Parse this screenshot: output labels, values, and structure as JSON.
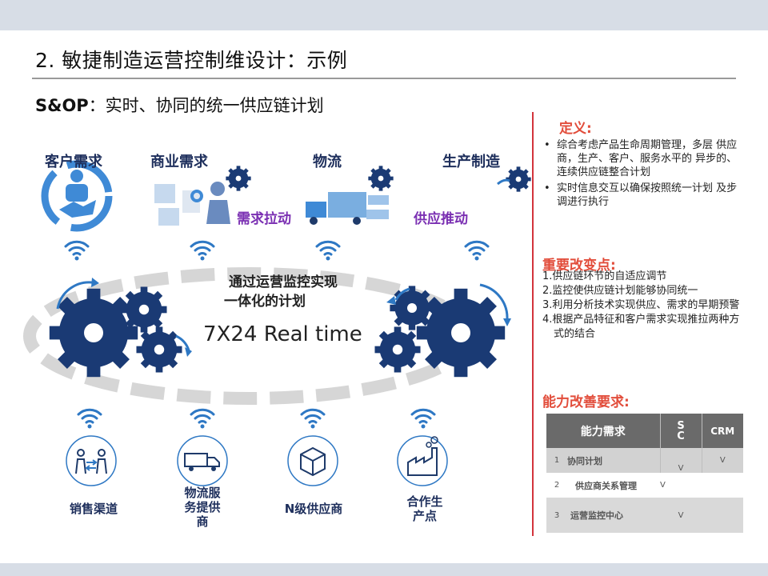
{
  "slide": {
    "title": "2. 敏捷制造运营控制维设计：示例",
    "subtitle_prefix": "S&OP",
    "subtitle_rest": "：实时、协同的统一供应链计划"
  },
  "top_nodes": [
    {
      "label": "客户需求",
      "icon": "customer-handshake-icon"
    },
    {
      "label": "商业需求",
      "icon": "business-people-icon"
    },
    {
      "label": "物流",
      "icon": "truck-icon"
    },
    {
      "label": "生产制造",
      "icon": "gear-icon"
    }
  ],
  "flows": {
    "pull": "需求拉动",
    "push": "供应推动"
  },
  "center": {
    "line1": "通过运营监控实现",
    "line2": "一体化的计划",
    "realtime": "7X24 Real time"
  },
  "bottom_nodes": [
    {
      "label": "销售渠道",
      "icon": "people-exchange-icon"
    },
    {
      "label": "物流服务提供商",
      "line1": "物流服",
      "line2": "务提供",
      "line3": "商",
      "icon": "truck-icon"
    },
    {
      "label": "N级供应商",
      "icon": "box-icon"
    },
    {
      "label": "合作生产点",
      "line1": "合作生",
      "line2": "产点",
      "icon": "factory-icon"
    }
  ],
  "definition": {
    "title": "定义:",
    "bullets": [
      "综合考虑产品生命周期管理，多层 供应商，生产、客户、服务水平的 异步的、连续供应链整合计划",
      "实时信息交互以确保按照统一计划 及步调进行执行"
    ]
  },
  "key_changes": {
    "title": "重要改变点:",
    "items": [
      "1.供应链环节的自适应调节",
      "2.监控使供应链计划能够协同统一",
      "3.利用分析技术实现供应、需求的早期预警",
      "4.根据产品特征和客户需求实现推拉两种方式的结合"
    ]
  },
  "capability": {
    "title": "能力改善要求:",
    "headers": [
      "能力需求",
      "SC",
      "CRM"
    ],
    "rows": [
      {
        "no": "1",
        "name": "协同计划",
        "sc": "V",
        "crm": "V"
      },
      {
        "no": "2",
        "name": "供应商关系管理",
        "sc": "V",
        "crm": ""
      },
      {
        "no": "3",
        "name": "运营监控中心",
        "sc": "V",
        "crm": ""
      }
    ]
  },
  "colors": {
    "navy": "#1e2f5c",
    "gear_blue": "#1a3a74",
    "icon_blue": "#2e78c4",
    "accent_red": "#e24d3b",
    "divider_red": "#d3343c",
    "flow_purple": "#7a2fb2"
  }
}
